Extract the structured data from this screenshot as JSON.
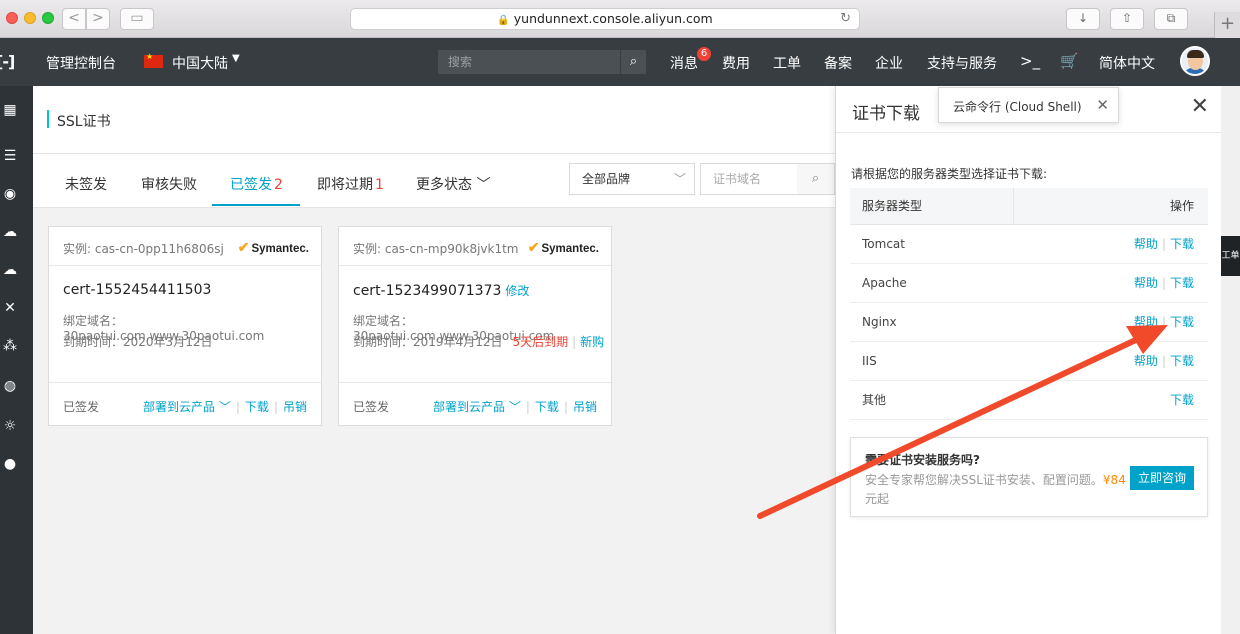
{
  "browser": {
    "url": "yundunnext.console.aliyun.com",
    "buttons": {
      "back": "<",
      "forward": ">",
      "sidebar": "▭",
      "download": "↓",
      "share": "⇧",
      "tabs": "⧉",
      "new_tab": "+",
      "reload": "↻"
    }
  },
  "topnav": {
    "logo": "[-]",
    "console_label": "管理控制台",
    "region": "中国大陆",
    "search_placeholder": "搜索",
    "messages_label": "消息",
    "messages_badge": "6",
    "items": [
      "费用",
      "工单",
      "备案",
      "企业",
      "支持与服务"
    ],
    "language": "简体中文"
  },
  "sidebar": {
    "icons": [
      "grid-icon",
      "server-icon",
      "database-icon",
      "cloud-icon",
      "cloud-upload-icon",
      "network-icon",
      "nodes-icon",
      "globe-icon",
      "cloud-shield-icon",
      "circle-icon"
    ]
  },
  "page": {
    "title": "SSL证书",
    "tabs": [
      {
        "label": "未签发",
        "count": ""
      },
      {
        "label": "审核失败",
        "count": ""
      },
      {
        "label": "已签发",
        "count": "2"
      },
      {
        "label": "即将过期",
        "count": "1"
      },
      {
        "label": "更多状态",
        "count": ""
      }
    ],
    "active_tab": "已签发",
    "brand_select": "全部品牌",
    "domain_placeholder": "证书域名"
  },
  "cards": [
    {
      "instance": "实例: cas-cn-0pp11h6806sj",
      "brand": "Symantec.",
      "cert_name": "cert-1552454411503",
      "edit_label": "",
      "domain_label": "绑定域名：",
      "domain_value": "30paotui.com,www.30paotui.com",
      "expiry_label": "到期时间：",
      "expiry_value": "2020年3月12日",
      "warning": "",
      "renew": "",
      "status": "已签发",
      "actions": {
        "deploy": "部署到云产品",
        "download": "下载",
        "revoke": "吊销"
      }
    },
    {
      "instance": "实例: cas-cn-mp90k8jvk1tm",
      "brand": "Symantec.",
      "cert_name": "cert-1523499071373",
      "edit_label": "修改",
      "domain_label": "绑定域名：",
      "domain_value": "30paotui.com,www.30paotui.com",
      "expiry_label": "到期时间：",
      "expiry_value": "2019年4月12日",
      "warning": "5天后到期",
      "renew": "新购",
      "status": "已签发",
      "actions": {
        "deploy": "部署到云产品",
        "download": "下载",
        "revoke": "吊销"
      }
    }
  ],
  "panel": {
    "title": "证书下载",
    "intro": "请根据您的服务器类型选择证书下载:",
    "col_server": "服务器类型",
    "col_action": "操作",
    "rows": [
      {
        "server": "Tomcat",
        "help": "帮助",
        "download": "下载"
      },
      {
        "server": "Apache",
        "help": "帮助",
        "download": "下载"
      },
      {
        "server": "Nginx",
        "help": "帮助",
        "download": "下载"
      },
      {
        "server": "IIS",
        "help": "帮助",
        "download": "下载"
      },
      {
        "server": "其他",
        "help": "",
        "download": "下载"
      }
    ],
    "promo": {
      "question": "需要证书安装服务吗?",
      "desc": "安全专家帮您解决SSL证书安装、配置问题。",
      "price": "¥84",
      "desc_tail": "元起",
      "button": "立即咨询"
    }
  },
  "tooltip": {
    "text": "云命令行 (Cloud Shell)"
  },
  "right_strip": {
    "ticket": "工单"
  },
  "colors": {
    "accent": "#00a2ca",
    "topnav": "#373d41",
    "danger": "#f04134",
    "price": "#ff8a00",
    "arrow": "#f04a2a"
  }
}
